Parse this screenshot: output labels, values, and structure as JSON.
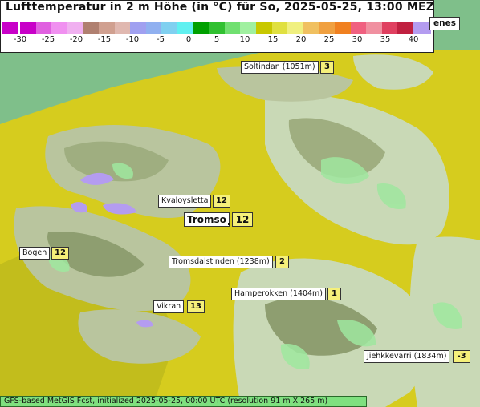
{
  "title": "Lufttemperatur in 2 m Höhe (in °C) für So, 2025-05-25, 13:00 MEZ",
  "legend": {
    "ticks": [
      "-30",
      "-25",
      "-20",
      "-15",
      "-10",
      "-5",
      "0",
      "5",
      "10",
      "15",
      "20",
      "25",
      "30",
      "35",
      "40"
    ],
    "colors": [
      "#c800c8",
      "#e060e0",
      "#f090f0",
      "#f0b0f0",
      "#b08070",
      "#d0a090",
      "#e0b8b0",
      "#a0a0f0",
      "#90b0f0",
      "#80d0f0",
      "#60f0f0",
      "#00a000",
      "#30c030",
      "#70e070",
      "#a0f0a0",
      "#c8c800",
      "#e0e040",
      "#f0f080",
      "#f0c060",
      "#f0a040",
      "#f08020",
      "#f06080",
      "#f090a0",
      "#e04060",
      "#c02040"
    ],
    "left_cap_color": "#c800c8",
    "right_cap_color": "#b49cf0"
  },
  "partial_label": "enes",
  "places": [
    {
      "name": "Soltindan (1051m)",
      "value": "3"
    },
    {
      "name": "Kvaloysletta",
      "value": "12"
    },
    {
      "name": "Tromso",
      "value": "12"
    },
    {
      "name": "Bogen",
      "value": "12"
    },
    {
      "name": "Tromsdalstinden (1238m)",
      "value": "2"
    },
    {
      "name": "Hamperokken (1404m)",
      "value": "1"
    },
    {
      "name": "Vikran",
      "value": "13"
    },
    {
      "name": "Jiehkkevarri (1834m)",
      "value": "-3"
    }
  ],
  "footer": "GFS-based MetGIS Fcst, initialized 2025-05-25, 00:00 UTC  (resolution 91 m X 265 m)",
  "colors": {
    "sea": "#d6cc1e",
    "lowland": "#c8c41c",
    "terrain_light": "#c9d9b6",
    "terrain_shadow": "#8c9c6e",
    "snow_green": "#9fe79f",
    "purple_patch": "#b49cf0",
    "ocean_green": "#7fbf8a"
  }
}
